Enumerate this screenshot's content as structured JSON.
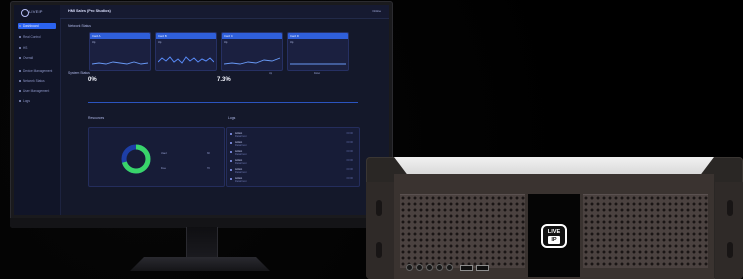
{
  "monitor_ui": {
    "logo_text": "LIVEIP",
    "top_title": "HMI Sales (Pro Studios)",
    "top_right": "Online",
    "nav_items": [
      "Dashboard",
      "Real Control",
      "HS",
      "Overall",
      "Device Management",
      "Network Status",
      "User Management",
      "Logs"
    ],
    "sections": {
      "network_status": "Network Status",
      "system_status": "System Status",
      "resources": "Resources",
      "logs": "Logs"
    },
    "cards": [
      "Card A",
      "Card B",
      "Card C",
      "Card D"
    ],
    "system_values": [
      "0%",
      "7.3%"
    ],
    "legend": [
      "Up",
      "Down"
    ],
    "resource_labels": [
      "Used",
      "Free"
    ],
    "resource_values": [
      "30",
      "70"
    ],
    "log_entries": [
      {
        "title": "Action",
        "desc": "Detail text",
        "time": "00:00"
      },
      {
        "title": "Action",
        "desc": "Detail text",
        "time": "00:00"
      },
      {
        "title": "Action",
        "desc": "Detail text",
        "time": "00:00"
      },
      {
        "title": "Action",
        "desc": "Detail text",
        "time": "00:00"
      },
      {
        "title": "Action",
        "desc": "Detail text",
        "time": "00:00"
      },
      {
        "title": "Action",
        "desc": "Detail text",
        "time": "00:00"
      }
    ]
  },
  "device": {
    "brand_top": "LIVE",
    "brand_bottom": "IP"
  },
  "colors": {
    "background": "#000000",
    "accent": "#2f5fda",
    "accent_active": "#2b63f0",
    "monitor_bezel": "#1a1a1d",
    "device_metal": "#3a3330",
    "device_top": "#e3e3e3"
  },
  "icons": {
    "logo": "logo-circle-icon",
    "nav": "nav-dot-icon",
    "log": "log-bullet-icon",
    "knob": "knob-icon",
    "usb": "usb-port-icon"
  }
}
